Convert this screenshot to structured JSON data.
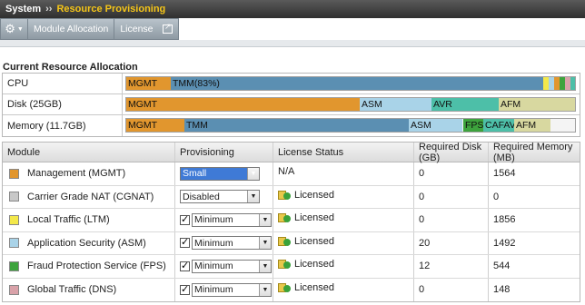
{
  "breadcrumb": {
    "root": "System",
    "separator": "››",
    "current": "Resource Provisioning"
  },
  "tabs": {
    "module_allocation": "Module Allocation",
    "license": "License"
  },
  "colors": {
    "mgmt": "#e1962e",
    "tmm": "#5b8fb2",
    "asm": "#a9d3e8",
    "avr": "#4dbfa8",
    "afm": "#d8d8a0",
    "fps": "#3da33d",
    "cgnat": "#c8c8c8",
    "ltm": "#f3e84a",
    "dns": "#d9a2a9"
  },
  "allocation": {
    "title": "Current Resource Allocation",
    "rows": [
      {
        "label": "CPU",
        "segments": [
          {
            "text": "MGMT",
            "start": 0.0,
            "width": 0.1,
            "color": "#e1962e"
          },
          {
            "text": "TMM(83%)",
            "start": 0.1,
            "width": 0.83,
            "color": "#5b8fb2"
          },
          {
            "text": "",
            "start": 0.93,
            "width": 0.012,
            "color": "#f3e84a"
          },
          {
            "text": "",
            "start": 0.942,
            "width": 0.012,
            "color": "#a9d3e8"
          },
          {
            "text": "",
            "start": 0.954,
            "width": 0.012,
            "color": "#e1962e"
          },
          {
            "text": "",
            "start": 0.966,
            "width": 0.012,
            "color": "#3da33d"
          },
          {
            "text": "",
            "start": 0.978,
            "width": 0.012,
            "color": "#d9a2a9"
          },
          {
            "text": "",
            "start": 0.99,
            "width": 0.01,
            "color": "#4dbfa8"
          }
        ]
      },
      {
        "label": "Disk (25GB)",
        "segments": [
          {
            "text": "MGMT",
            "start": 0.0,
            "width": 0.52,
            "color": "#e1962e"
          },
          {
            "text": "ASM",
            "start": 0.52,
            "width": 0.16,
            "color": "#a9d3e8"
          },
          {
            "text": "AVR",
            "start": 0.68,
            "width": 0.15,
            "color": "#4dbfa8"
          },
          {
            "text": "AFM",
            "start": 0.83,
            "width": 0.17,
            "color": "#d8d8a0"
          }
        ]
      },
      {
        "label": "Memory (11.7GB)",
        "segments": [
          {
            "text": "MGMT",
            "start": 0.0,
            "width": 0.13,
            "color": "#e1962e"
          },
          {
            "text": "TMM",
            "start": 0.13,
            "width": 0.5,
            "color": "#5b8fb2"
          },
          {
            "text": "ASM",
            "start": 0.63,
            "width": 0.12,
            "color": "#a9d3e8"
          },
          {
            "text": "FPS",
            "start": 0.75,
            "width": 0.045,
            "color": "#3da33d"
          },
          {
            "text": "CAFAVR",
            "start": 0.795,
            "width": 0.07,
            "color": "#4dbfa8"
          },
          {
            "text": "AFM",
            "start": 0.865,
            "width": 0.08,
            "color": "#d8d8a0"
          }
        ]
      }
    ]
  },
  "modules_table": {
    "headers": [
      "Module",
      "Provisioning",
      "License Status",
      "Required Disk (GB)",
      "Required Memory (MB)"
    ],
    "rows": [
      {
        "name": "Management (MGMT)",
        "color": "#e1962e",
        "checkbox": null,
        "provisioning": "Small",
        "license": "N/A",
        "licensed_icon": false,
        "disk": "0",
        "memory": "1564"
      },
      {
        "name": "Carrier Grade NAT (CGNAT)",
        "color": "#c8c8c8",
        "checkbox": null,
        "provisioning": "Disabled",
        "license": "Licensed",
        "licensed_icon": true,
        "disk": "0",
        "memory": "0"
      },
      {
        "name": "Local Traffic (LTM)",
        "color": "#f3e84a",
        "checkbox": true,
        "provisioning": "Minimum",
        "license": "Licensed",
        "licensed_icon": true,
        "disk": "0",
        "memory": "1856"
      },
      {
        "name": "Application Security (ASM)",
        "color": "#a9d3e8",
        "checkbox": true,
        "provisioning": "Minimum",
        "license": "Licensed",
        "licensed_icon": true,
        "disk": "20",
        "memory": "1492"
      },
      {
        "name": "Fraud Protection Service (FPS)",
        "color": "#3da33d",
        "checkbox": true,
        "provisioning": "Minimum",
        "license": "Licensed",
        "licensed_icon": true,
        "disk": "12",
        "memory": "544"
      },
      {
        "name": "Global Traffic (DNS)",
        "color": "#d9a2a9",
        "checkbox": true,
        "provisioning": "Minimum",
        "license": "Licensed",
        "licensed_icon": true,
        "disk": "0",
        "memory": "148"
      }
    ]
  }
}
